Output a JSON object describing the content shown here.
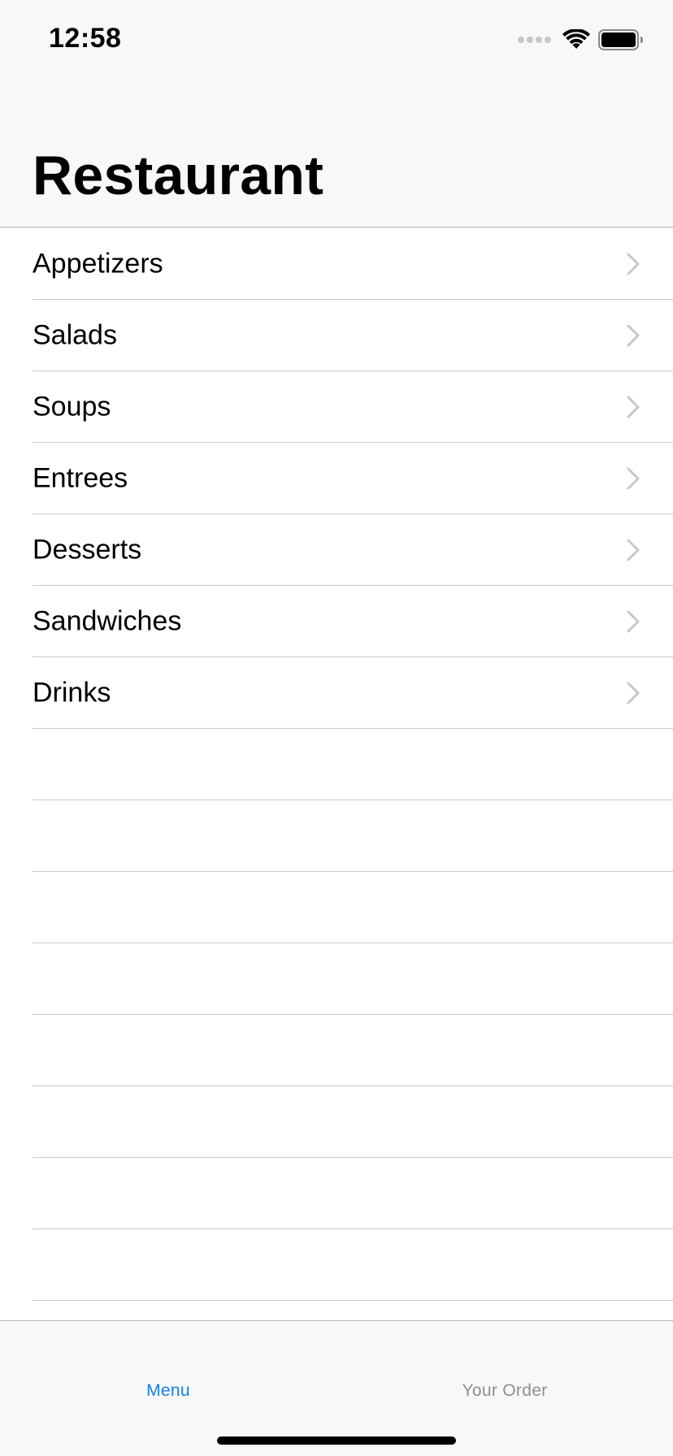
{
  "status_bar": {
    "time": "12:58",
    "signal_icon": "signal-dots-icon",
    "wifi_icon": "wifi-icon",
    "battery_icon": "battery-icon"
  },
  "nav": {
    "title": "Restaurant"
  },
  "menu": {
    "categories": [
      "Appetizers",
      "Salads",
      "Soups",
      "Entrees",
      "Desserts",
      "Sandwiches",
      "Drinks"
    ],
    "chevron_icon": "chevron-right-icon",
    "empty_row_count": 8
  },
  "tab_bar": {
    "tabs": [
      {
        "label": "Menu",
        "selected": true
      },
      {
        "label": "Your Order",
        "selected": false
      }
    ],
    "active_color": "#1a7fe0",
    "inactive_color": "#8e8e93"
  },
  "colors": {
    "bar_background": "#f8f8f8",
    "separator": "#c8c7cc",
    "chevron": "#c7c7cc"
  }
}
